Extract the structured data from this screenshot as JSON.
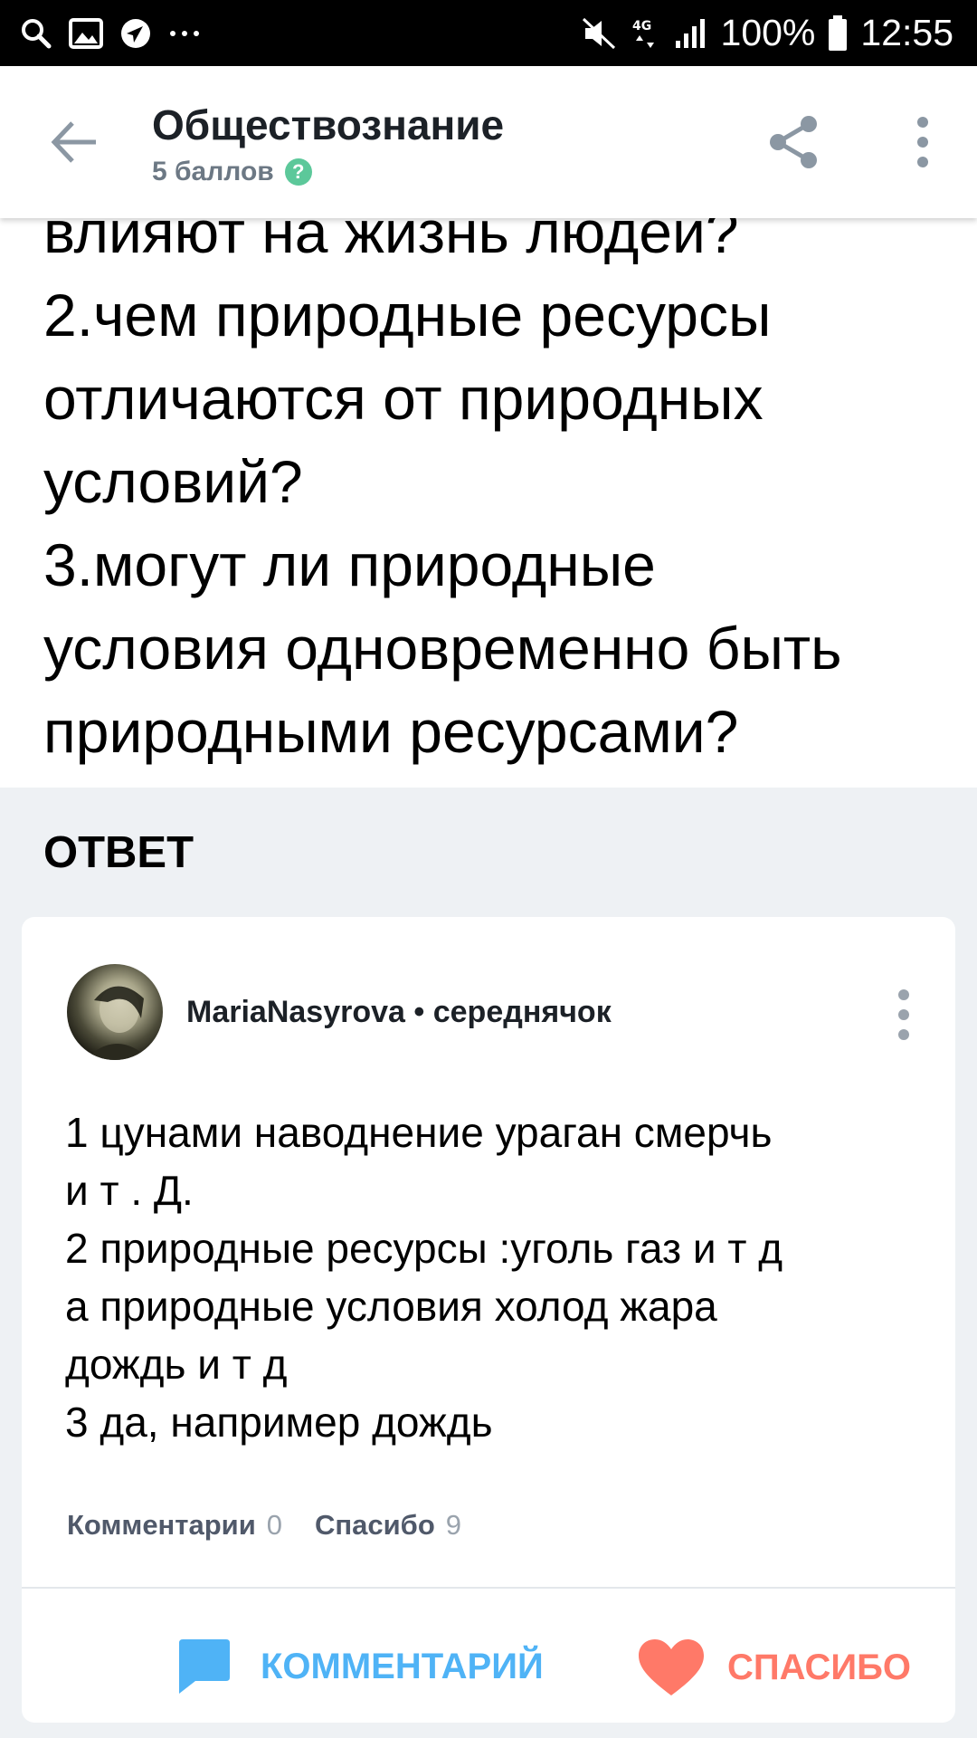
{
  "status_bar": {
    "icons_left": [
      "search-icon",
      "gallery-icon",
      "navigation-icon",
      "more-notifications-icon"
    ],
    "icons_right": [
      "mute-icon",
      "4g-icon",
      "signal-icon",
      "battery-icon"
    ],
    "network": "4G",
    "battery": "100%",
    "time": "12:55"
  },
  "app_bar": {
    "title": "Обществознание",
    "subtitle": "5 баллов",
    "help_glyph": "?"
  },
  "question": {
    "text": "влияют на жизнь людей?\n2.чем природные ресурсы\nотличаются от природных\nусловий?\n3.могут ли природные\nусловия одновременно быть\nприродными ресурсами?"
  },
  "answer": {
    "heading": "ОТВЕТ",
    "author": "MariaNasyrova",
    "separator": "•",
    "rank": "середнячок",
    "text": "1 цунами наводнение ураган смерчь\nи т . Д.\n2 природные ресурсы :уголь газ и т д\nа природные условия холод жара\nдождь и т д\n3 да, например дождь",
    "comments_label": "Комментарии",
    "comments_count": "0",
    "thanks_label": "Спасибо",
    "thanks_count": "9",
    "comment_button": "КОММЕНТАРИЙ",
    "thanks_button": "СПАСИБО"
  },
  "colors": {
    "accent_blue": "#4fb3f6",
    "accent_red": "#ff7968",
    "help_green": "#5cc89a",
    "background_gray": "#eef1f4"
  }
}
